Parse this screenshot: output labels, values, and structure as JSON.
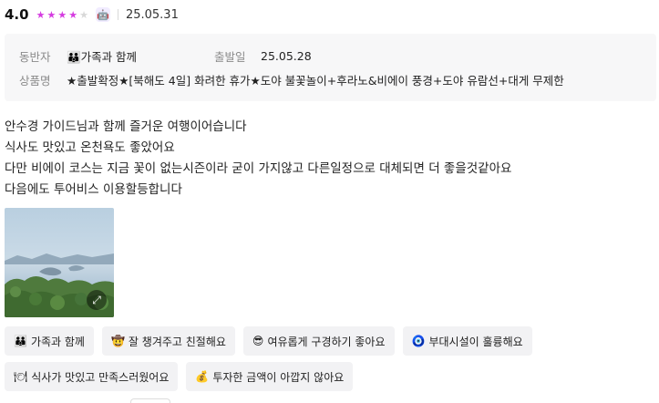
{
  "review": {
    "score": "4.0",
    "rating_stars": 4,
    "rating_max": 5,
    "star_color": "#d53ce0",
    "star_empty_color": "#d8d8d8",
    "badge_icon": "robot-face-icon",
    "date": "25.05.31"
  },
  "info": {
    "companion_label": "동반자",
    "companion_icon": "family-icon",
    "companion_value": "가족과 함께",
    "departure_label": "출발일",
    "departure_value": "25.05.28",
    "product_label": "상품명",
    "product_value": "★출발확정★[북해도 4일] 화려한 휴가★도야 불꽃놀이+후라노&비에이 풍경+도야 유람선+대게 무제한"
  },
  "body_lines": [
    "안수경 가이드님과 함께 즐거운 여행이어습니다",
    "식사도 맛있고 온천욕도 좋았어요",
    "다만 비에이 코스는 지금 꽃이 없는시즌이라 굳이 가지않고 다른일정으로 대체되면 더 좋을것같아요",
    "다음에도 투어비스 이용할등합니다"
  ],
  "photo": {
    "icon": "expand-icon"
  },
  "tags": [
    {
      "emoji": "👪",
      "label": "가족과 함께"
    },
    {
      "emoji": "🤠",
      "label": "잘 챙겨주고 친절해요"
    },
    {
      "emoji": "😎",
      "label": "여유롭게 구경하기 좋아요"
    },
    {
      "emoji": "🧿",
      "label": "부대시설이 훌륭해요"
    },
    {
      "emoji": "🍽",
      "label": "식사가 맛있고 만족스러웠어요"
    },
    {
      "emoji": "💰",
      "label": "투자한 금액이 아깝지 않아요"
    }
  ]
}
